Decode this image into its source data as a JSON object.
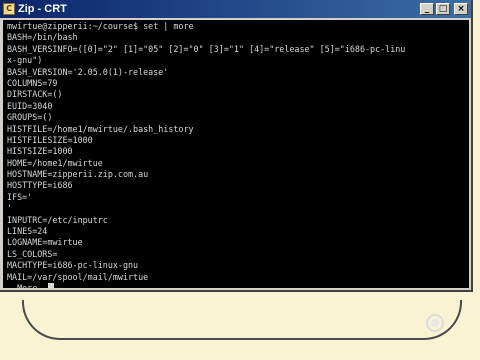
{
  "window": {
    "title": "Zip - CRT",
    "icon": "crt-app-icon",
    "controls": {
      "minimize": "_",
      "maximize": "□",
      "close": "×"
    }
  },
  "terminal": {
    "lines": [
      "mwirtue@zipperii:~/course$ set | more",
      "BASH=/bin/bash",
      "BASH_VERSINFO=([0]=\"2\" [1]=\"05\" [2]=\"0\" [3]=\"1\" [4]=\"release\" [5]=\"i686-pc-linu",
      "x-gnu\")",
      "BASH_VERSION='2.05.0(1)-release'",
      "COLUMNS=79",
      "DIRSTACK=()",
      "EUID=3040",
      "GROUPS=()",
      "HISTFILE=/home1/mwirtue/.bash_history",
      "HISTFILESIZE=1000",
      "HISTSIZE=1000",
      "HOME=/home1/mwirtue",
      "HOSTNAME=zipperii.zip.com.au",
      "HOSTTYPE=i686",
      "IFS='",
      "'",
      "INPUTRC=/etc/inputrc",
      "LINES=24",
      "LOGNAME=mwirtue",
      "LS_COLORS=",
      "MACHTYPE=i686-pc-linux-gnu",
      "MAIL=/var/spool/mail/mwirtue",
      "--More--"
    ]
  }
}
